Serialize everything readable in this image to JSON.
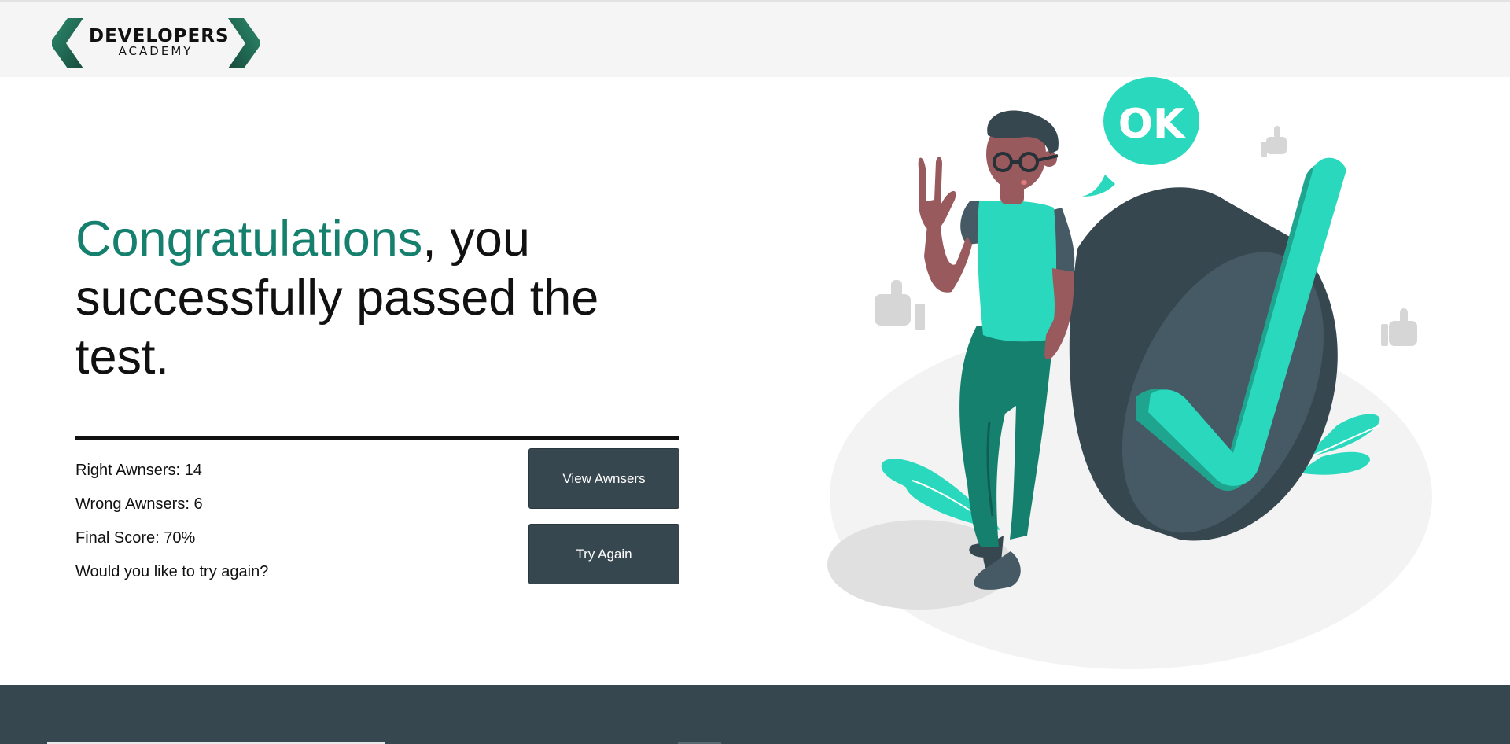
{
  "header": {
    "logo": {
      "name": "DEVELOPERS",
      "sub": "ACADEMY"
    }
  },
  "main": {
    "heading_accent": "Congratulations",
    "heading_rest": ", you successfully passed the test.",
    "stats": {
      "right": "Right Awnsers: 14",
      "wrong": "Wrong Awnsers: 6",
      "score": "Final Score: 70%",
      "prompt": "Would you like to try again?"
    },
    "buttons": {
      "view": "View Awnsers",
      "try": "Try Again"
    }
  },
  "illustration": {
    "bubble_text": "OK"
  },
  "colors": {
    "accent": "#16806e",
    "mint": "#2ad9bd",
    "button_bg": "#37474f",
    "footer_bg": "#37474f",
    "header_bg": "#f5f5f5"
  }
}
